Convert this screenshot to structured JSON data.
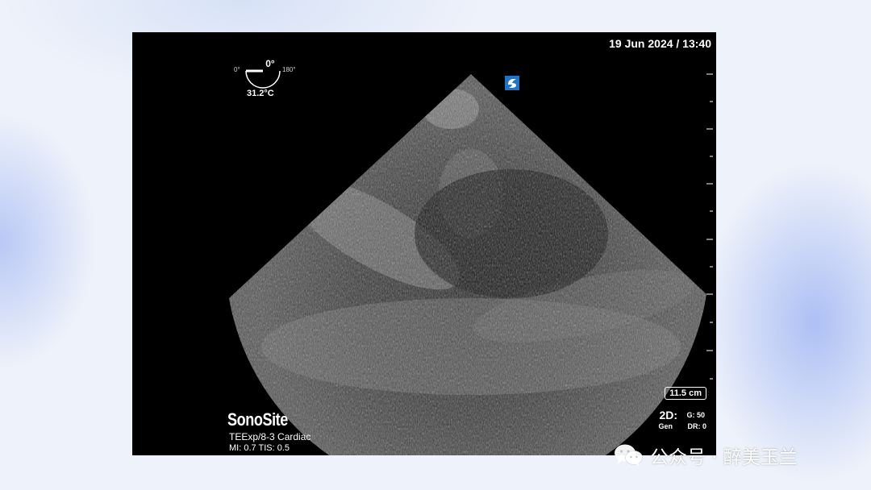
{
  "overlay": {
    "datetime": "19 Jun 2024 / 13:40",
    "angle_value": "0°",
    "angle_min": "0°",
    "angle_max": "180°",
    "temperature": "31.2°C",
    "depth": "11.5 cm",
    "mode": "2D:",
    "gain": "G: 50",
    "preset": "Gen",
    "dynamic_range": "DR: 0",
    "brand": "SonoSite",
    "probe_info": "TEExp/8-3  Cardiac",
    "mi_tis": "MI: 0.7  TIS: 0.5"
  },
  "watermark": {
    "icon": "wechat-icon",
    "text": "公众号 · 醉美玉兰"
  },
  "colors": {
    "background": "#eef2fa",
    "frame": "#000000",
    "overlay_text": "#ffffff",
    "logo_blue": "#1f74c8"
  }
}
